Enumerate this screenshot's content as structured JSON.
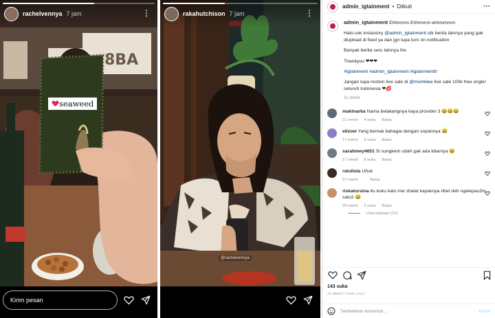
{
  "story_left": {
    "username": "rachelvennya",
    "time": "7 jam",
    "sticker_text": "seaweed",
    "reply_placeholder": "Kirim pesan",
    "progress": 0.6
  },
  "story_right": {
    "username": "rakahutchison",
    "time": "7 jam",
    "mention_tag": "@rachelvennya",
    "progress": 0.4
  },
  "post": {
    "header": {
      "username": "admin_igtainment",
      "separator": "•",
      "follow_label": "Diikuti"
    },
    "caption": {
      "username": "admin_igtainment",
      "line1": "Ehhmmm Ehhmmm ehhmmmm",
      "p1_pre": "Halo cek instastory ",
      "p1_mention": "@admin_igtainment",
      "p1_post": " utk berita lainnya yang gak diupload di feed ya dan jgn lupa turn on notification",
      "p2": "Banyak berita seru lainnya lho",
      "p3": "Thankyou ❤❤❤",
      "hashtags": "#igtainment #admin_igtainment #igtainmenttt",
      "p5_pre": "Jangan lupa nonton live sale di ",
      "p5_mention": "@momkiee",
      "p5_post": " live sale 100k free ongkir seluruh Indonesia ❤💋",
      "time": "31 menit"
    },
    "comments": [
      {
        "user": "makinarka",
        "text": "Nama belakangnya kaya provider 3 😂😂😂",
        "time": "21 menit",
        "likes": "4 suka",
        "reply": "Balas",
        "color": "#5d6b78"
      },
      {
        "user": "elizoel",
        "text": "Yang bernak bahagia dengan sopannya 😂",
        "time": "17 menit",
        "likes": "9 suka",
        "reply": "Balas",
        "color": "#8b7fc7"
      },
      {
        "user": "sarahmey4651",
        "text": "Si sungkem udah gak ada kbarnya 😂",
        "time": "17 menit",
        "likes": "8 suka",
        "reply": "Balas",
        "color": "#6e7b86"
      },
      {
        "user": "ratulista",
        "text": "Uhuk",
        "time": "27 menit",
        "likes": "",
        "reply": "Balas",
        "color": "#3a2a24"
      },
      {
        "user": "riskatursina",
        "text": "itu kuku kalo mw shalat kayaknya ribet deh ngelepas2in satu2 😂",
        "time": "29 menit",
        "likes": "2 suka",
        "reply": "Balas",
        "color": "#c98f6a"
      }
    ],
    "view_replies": "Lihat balasan (10)",
    "likes": "143 suka",
    "posted": "31 MENIT YANG LALU",
    "add_comment_placeholder": "Tambahkan komentar...",
    "post_label": "Kirim"
  },
  "icons": {
    "heart": "heart-icon",
    "send": "send-icon",
    "comment": "comment-icon",
    "bookmark": "bookmark-icon",
    "emoji": "emoji-icon",
    "more": "more-icon"
  }
}
